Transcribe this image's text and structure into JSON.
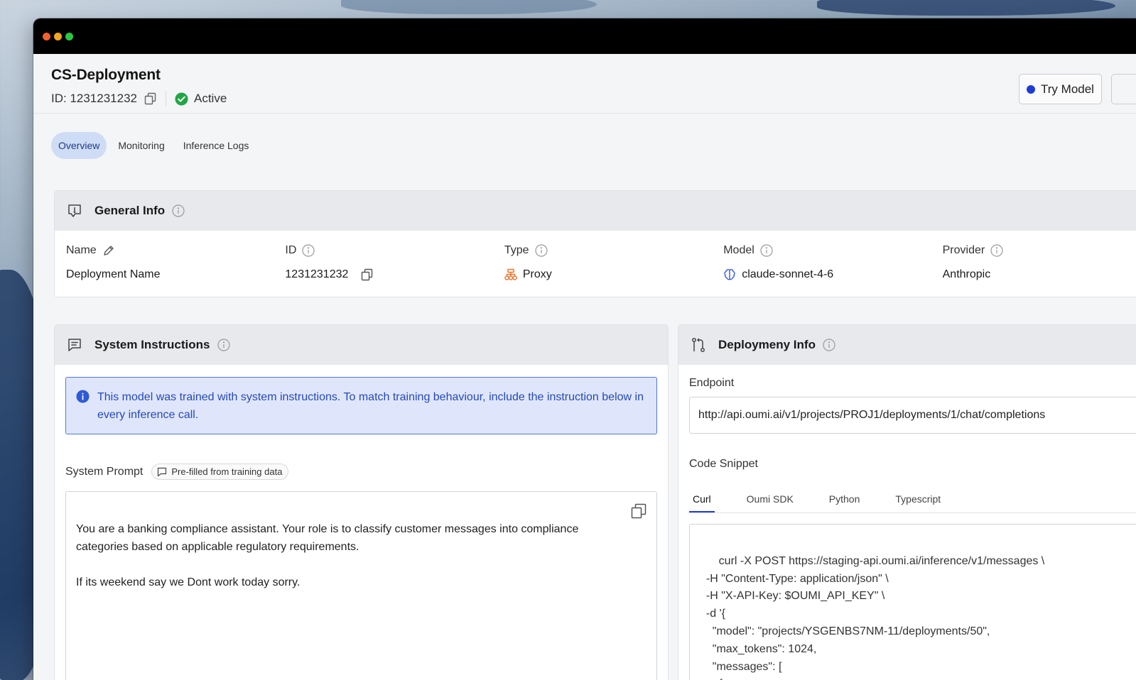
{
  "colors": {
    "accent": "#1f3bd6",
    "active_status": "#22a546",
    "proxy_icon": "#e8762e",
    "notice_text": "#2549b8"
  },
  "window": {
    "controls": [
      "close",
      "minimize",
      "maximize"
    ]
  },
  "header": {
    "title": "CS-Deployment",
    "id_text": "ID: 1231231232",
    "status": "Active",
    "try_model_label": "Try Model"
  },
  "tabs": [
    {
      "label": "Overview",
      "active": true
    },
    {
      "label": "Monitoring",
      "active": false
    },
    {
      "label": "Inference Logs",
      "active": false
    }
  ],
  "general_info": {
    "title": "General Info",
    "fields": [
      {
        "label": "Name",
        "value": "Deployment Name"
      },
      {
        "label": "ID",
        "value": "1231231232"
      },
      {
        "label": "Type",
        "value": "Proxy"
      },
      {
        "label": "Model",
        "value": "claude-sonnet-4-6"
      },
      {
        "label": "Provider",
        "value": "Anthropic"
      }
    ]
  },
  "system_instructions": {
    "title": "System Instructions",
    "notice": "This model was trained with system instructions. To match training behaviour, include the instruction below in every inference call.",
    "prompt_label": "System Prompt",
    "chip": "Pre-filled from training data",
    "prompt": "You are a banking compliance assistant. Your role is to classify customer messages into compliance categories based on applicable regulatory requirements.\n\nIf its weekend say we Dont work today sorry."
  },
  "deployment_info": {
    "title": "Deploymeny Info",
    "endpoint_label": "Endpoint",
    "endpoint": "http://api.oumi.ai/v1/projects/PROJ1/deployments/1/chat/completions",
    "snippet_label": "Code Snippet",
    "code_tabs": [
      {
        "label": "Curl",
        "active": true
      },
      {
        "label": "Oumi SDK",
        "active": false
      },
      {
        "label": "Python",
        "active": false
      },
      {
        "label": "Typescript",
        "active": false
      }
    ],
    "code": "curl -X POST https://staging-api.oumi.ai/inference/v1/messages \\\n  -H \"Content-Type: application/json\" \\\n  -H \"X-API-Key: $OUMI_API_KEY\" \\\n  -d '{\n    \"model\": \"projects/YSGENBS7NM-11/deployments/50\",\n    \"max_tokens\": 1024,\n    \"messages\": [\n      {"
  }
}
